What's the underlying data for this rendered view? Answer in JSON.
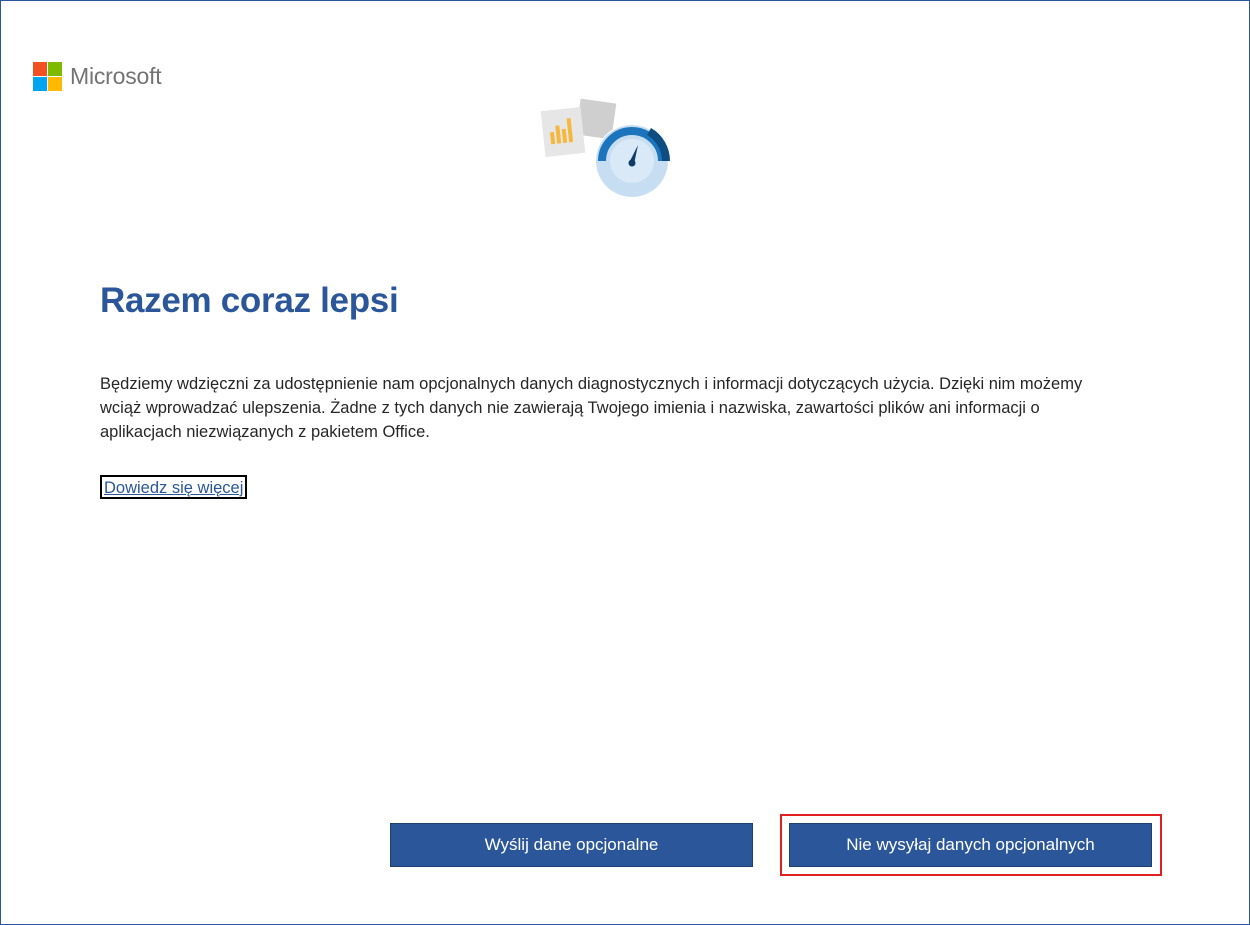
{
  "brand": {
    "name": "Microsoft",
    "logo_colors": [
      "#f25022",
      "#7fba00",
      "#00a4ef",
      "#ffb900"
    ]
  },
  "illustration": {
    "icon": "diagnostics-gauge-illustration"
  },
  "main": {
    "title": "Razem coraz lepsi",
    "body": "Będziemy wdzięczni za udostępnienie nam opcjonalnych danych diagnostycznych i informacji dotyczących użycia. Dzięki nim możemy wciąż wprowadzać ulepszenia. Żadne z tych danych nie zawierają Twojego imienia i nazwiska, zawartości plików ani informacji o aplikacjach niezwiązanych z pakietem Office.",
    "learn_more_link": "Dowiedz się więcej"
  },
  "buttons": {
    "send_optional": "Wyślij dane opcjonalne",
    "dont_send_optional": "Nie wysyłaj danych opcjonalnych"
  },
  "colors": {
    "accent": "#2b579a",
    "highlight": "#e02020"
  }
}
